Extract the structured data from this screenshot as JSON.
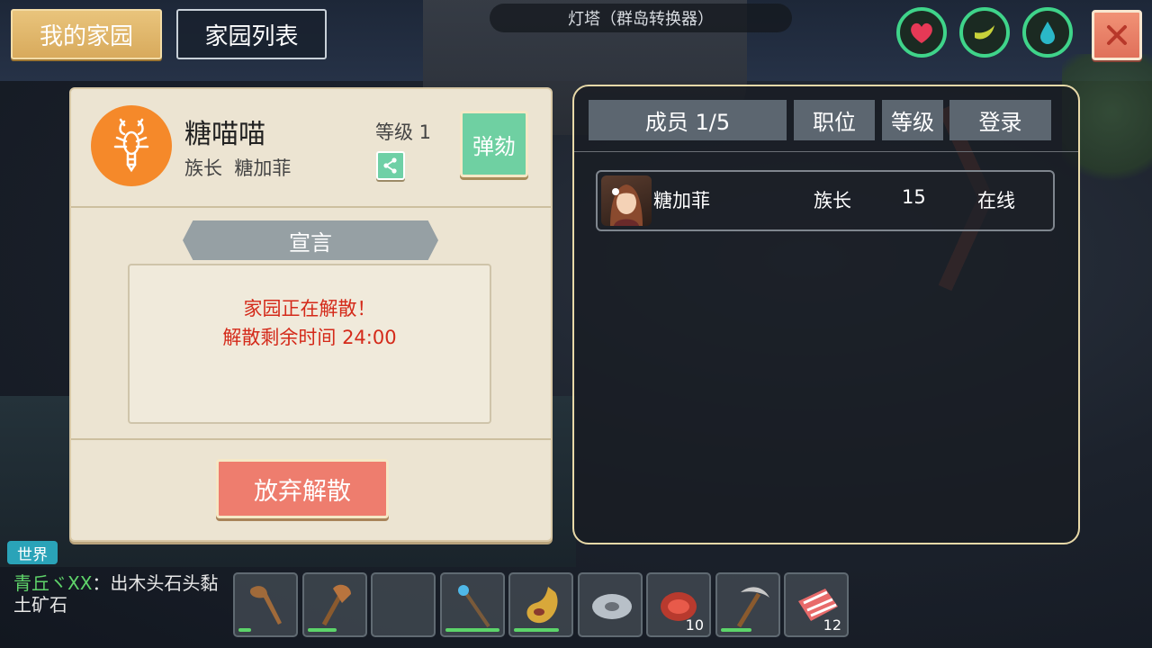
{
  "top_bar": {
    "tab_mine": "我的家园",
    "tab_list": "家园列表",
    "map_title": "灯塔（群岛转换器）"
  },
  "stats": {
    "health_color": "#e63956",
    "hunger_color": "#c8d23a",
    "water_color": "#2ab8c8",
    "ring_color": "#3fd48a"
  },
  "home": {
    "name": "糖喵喵",
    "role_label": "族长",
    "leader_name": "糖加菲",
    "level_label": "等级 1",
    "impeach_label": "弹劾",
    "declaration_title": "宣言",
    "declaration_line1": "家园正在解散！",
    "declaration_line2": "解散剩余时间 24:00",
    "cancel_dissolve_label": "放弃解散",
    "emblem_color": "#f5892a"
  },
  "members": {
    "headers": {
      "member_count": "成员 1/5",
      "position": "职位",
      "level": "等级",
      "login": "登录"
    },
    "rows": [
      {
        "name": "糖加菲",
        "position": "族长",
        "level": "15",
        "status": "在线"
      }
    ]
  },
  "chat": {
    "channel": "世界",
    "sender": "青丘ヾXX",
    "separator": "：",
    "message": "出木头石头黏土矿石"
  },
  "hotbar": {
    "slots": [
      {
        "icon": "club-icon",
        "count": ""
      },
      {
        "icon": "stone-axe-icon",
        "count": ""
      },
      {
        "icon": "empty-slot",
        "count": ""
      },
      {
        "icon": "crystal-staff-icon",
        "count": ""
      },
      {
        "icon": "gourd-flask-icon",
        "count": ""
      },
      {
        "icon": "stone-disc-icon",
        "count": ""
      },
      {
        "icon": "meat-icon",
        "count": "10"
      },
      {
        "icon": "pickaxe-icon",
        "count": ""
      },
      {
        "icon": "raw-bacon-icon",
        "count": "12"
      }
    ]
  }
}
